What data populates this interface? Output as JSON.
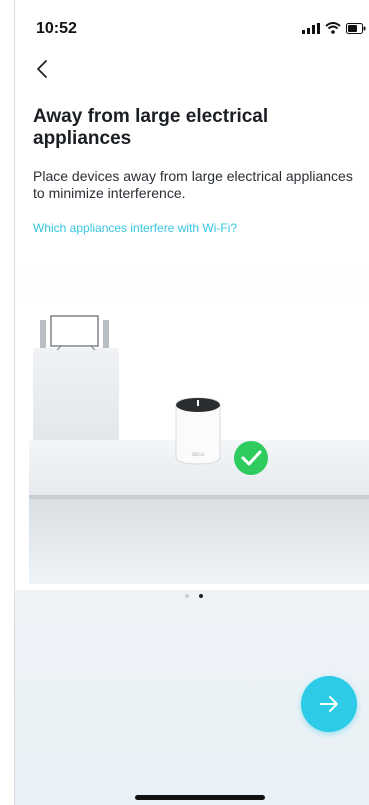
{
  "status": {
    "time": "10:52"
  },
  "page": {
    "title": "Away from large electrical appliances",
    "description": "Place devices away from large electrical appliances to minimize interference.",
    "link": "Which appliances interfere with Wi-Fi?"
  },
  "illustration": {
    "device_label": "deco"
  },
  "pager": {
    "total": 2,
    "active": 2
  },
  "colors": {
    "accent": "#2dcbe7",
    "check": "#2ecc5f"
  }
}
